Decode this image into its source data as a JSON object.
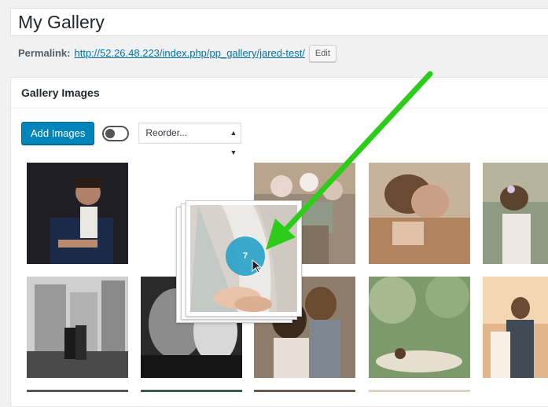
{
  "title": {
    "value": "My Gallery"
  },
  "permalink": {
    "label": "Permalink:",
    "url": "http://52.26.48.223/index.php/pp_gallery/jared-test/",
    "edit_label": "Edit"
  },
  "gallery": {
    "heading": "Gallery Images",
    "add_button": "Add Images",
    "reorder_select": "Reorder...",
    "dragged_count": "7"
  },
  "colors": {
    "accent": "#0085ba",
    "link": "#0073aa",
    "badge": "#2aa3c9",
    "annotation_arrow": "#2ecc1a"
  },
  "icons": [
    "toggle-switch-icon",
    "select-caret-icon",
    "move-cursor-icon",
    "green-arrow-annotation"
  ]
}
